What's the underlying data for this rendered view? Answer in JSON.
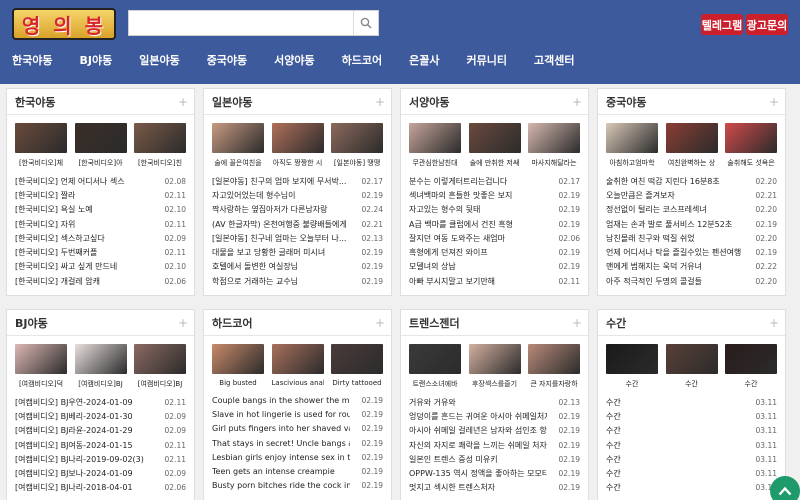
{
  "header": {
    "logo_text": "영 의 봉",
    "search_placeholder": "",
    "buttons": [
      "텔레그램",
      "광고문의"
    ]
  },
  "nav": [
    "한국야동",
    "BJ야동",
    "일본야동",
    "중국야동",
    "서양야동",
    "하드코어",
    "은꼴사",
    "커뮤니티",
    "고객센터"
  ],
  "colors": {
    "header": "#3d5a9c",
    "accent_red": "#cc1f2c",
    "fab": "#1f9a6a"
  },
  "panels": [
    {
      "title": "한국야동",
      "thumbs": [
        "[한국비디오]체",
        "[한국비디오]아",
        "[한국비디오]친"
      ],
      "thumb_colors": [
        "#6a4a3a",
        "#3a2e28",
        "#7a5a48"
      ],
      "items": [
        {
          "title": "[한국비디오] 언제 어디서나 섹스",
          "date": "02.08"
        },
        {
          "title": "[한국비디오] 짤라",
          "date": "02.11"
        },
        {
          "title": "[한국비디오] 욕실 노예",
          "date": "02.10"
        },
        {
          "title": "[한국비디오] 자위",
          "date": "02.11"
        },
        {
          "title": "[한국비디오] 섹스하고싶다",
          "date": "02.09"
        },
        {
          "title": "[한국비디오] 두번째커플",
          "date": "02.11"
        },
        {
          "title": "[한국비디오] 싸고 싶게 만드네",
          "date": "02.10"
        },
        {
          "title": "[한국비디오] 개걸레 암캐",
          "date": "02.06"
        }
      ]
    },
    {
      "title": "일본야동",
      "thumbs": [
        "술에 꼴은여친을",
        "아직도 짱짱한 시",
        "[일본야동] 땡땡"
      ],
      "thumb_colors": [
        "#c89a82",
        "#b0705a",
        "#8c6a5c"
      ],
      "items": [
        {
          "title": "[일본야동] 친구의 엄마 보지에 무서박...",
          "date": "02.17"
        },
        {
          "title": "자고있어었는데 형수님이",
          "date": "02.19"
        },
        {
          "title": "짝사랑하는 옆집아저가 다른남자랑",
          "date": "02.24"
        },
        {
          "title": "(AV 한글자막) 온천여행중 불량배들에게",
          "date": "02.21"
        },
        {
          "title": "[일본야동] 친구네 엄마는 오늘부터 나...",
          "date": "02.13"
        },
        {
          "title": "대물을 보고 당황한 글래머 미시녀",
          "date": "02.19"
        },
        {
          "title": "호텔에서 돌변한 여실장님",
          "date": "02.19"
        },
        {
          "title": "학점으로 거래하는 교수님",
          "date": "02.19"
        }
      ]
    },
    {
      "title": "서양야동",
      "thumbs": [
        "무관심한남친대",
        "술에 만취한 저쌔",
        "마사지해달라는"
      ],
      "thumb_colors": [
        "#c6a59a",
        "#6b4a3e",
        "#d6b8ae"
      ],
      "items": [
        {
          "title": "분수는 이렇게터트리는겁니다",
          "date": "02.17"
        },
        {
          "title": "섹녀백마의 흔들한 맛좋은 보지",
          "date": "02.19"
        },
        {
          "title": "자고있는 형수의 뒷태",
          "date": "02.19"
        },
        {
          "title": "A급 백마를 클럽에서 건진 흑형",
          "date": "02.19"
        },
        {
          "title": "잘지던 여동 도와주는 새엄마",
          "date": "02.06"
        },
        {
          "title": "흑형에게 던져진 와이프",
          "date": "02.19"
        },
        {
          "title": "모델녀의 상납",
          "date": "02.19"
        },
        {
          "title": "아빠 부시지말고 보기만해",
          "date": "02.11"
        }
      ]
    },
    {
      "title": "중국야동",
      "thumbs": [
        "아침하고엄마학",
        "여친완벽하는 상",
        "술취해도 섯욕은"
      ],
      "thumb_colors": [
        "#d9c8b8",
        "#8a3e34",
        "#d04a4a"
      ],
      "items": [
        {
          "title": "술취한 여친 떡감 지린다 16분8초",
          "date": "02.20"
        },
        {
          "title": "오늘만큼은 즐겨보자",
          "date": "02.21"
        },
        {
          "title": "정선없이 털리는 코스프레섹녀",
          "date": "02.20"
        },
        {
          "title": "엄재는 손과 발로 풀서비스 12분52초",
          "date": "02.19"
        },
        {
          "title": "남친몰래 친구와 떡질 쉬었",
          "date": "02.20"
        },
        {
          "title": "언제 어디서나 탁을 즐길수있는 펜션여행",
          "date": "02.19"
        },
        {
          "title": "맨에게 범해지는 욱덕 거유녀",
          "date": "02.22"
        },
        {
          "title": "아주 적극적인 두명의 콜걸들",
          "date": "02.20"
        }
      ]
    },
    {
      "title": "BJ야동",
      "thumbs": [
        "[여캠비디오]덕",
        "[여캠비디오]BJ",
        "[여캠비디오]BJ"
      ],
      "thumb_colors": [
        "#ddb8b4",
        "#e8e0de",
        "#8c6a62"
      ],
      "items": [
        {
          "title": "[여캠비디오] BJ우연-2024-01-09",
          "date": "02.11"
        },
        {
          "title": "[여캠비디오] BJ베리-2024-01-30",
          "date": "02.09"
        },
        {
          "title": "[여캠비디오] BJ라윤-2024-01-29",
          "date": "02.09"
        },
        {
          "title": "[여캠비디오] BJ여동-2024-01-15",
          "date": "02.11"
        },
        {
          "title": "[여캠비디오] BJ나리-2019-09-02(3)",
          "date": "02.11"
        },
        {
          "title": "[여캠비디오] BJ보나-2024-01-09",
          "date": "02.09"
        },
        {
          "title": "[여캠비디오] BJ나리-2018-04-01",
          "date": "02.06"
        }
      ]
    },
    {
      "title": "하드코어",
      "thumbs": [
        "Big busted",
        "Lascivious anal",
        "Dirty tattooed"
      ],
      "thumb_colors": [
        "#c98a6a",
        "#a8705c",
        "#4a3c3a"
      ],
      "items": [
        {
          "title": "Couple bangs in the shower the mornin...",
          "date": "02.19"
        },
        {
          "title": "Slave in hot lingerie is used for rough fu...",
          "date": "02.19"
        },
        {
          "title": "Girl puts fingers into her shaved vagina",
          "date": "02.19"
        },
        {
          "title": "That stays in secret! Uncle bangs a teen'...",
          "date": "02.19"
        },
        {
          "title": "Lesbian girls enjoy intense sex in the livi...",
          "date": "02.19"
        },
        {
          "title": "Teen gets an intense creampie",
          "date": "02.19"
        },
        {
          "title": "Busty porn bitches ride the cock in turns",
          "date": "02.19"
        }
      ]
    },
    {
      "title": "트렌스젠더",
      "thumbs": [
        "트랜스소녀에바",
        "후장섹스를즐기",
        "큰 자지를자랑하"
      ],
      "thumb_colors": [
        "#3a3a3a",
        "#d4b0a0",
        "#b88a7a"
      ],
      "items": [
        {
          "title": "거유와 거유와",
          "date": "02.13"
        },
        {
          "title": "엉덩이를 흔드는 귀여운 아시아 쉬메일처자",
          "date": "02.19"
        },
        {
          "title": "아시아 쉬메일 걸레년은 남자와 섬인조 항문섹...",
          "date": "02.19"
        },
        {
          "title": "자신의 자지로 쾌락을 느끼는 쉬메일 처자",
          "date": "02.19"
        },
        {
          "title": "일본인 트렌스 중성 미유키",
          "date": "02.19"
        },
        {
          "title": "OPPW-135 역시 정액을 좋아하는 모모타니 리리",
          "date": "02.19"
        },
        {
          "title": "멋지고 섹시한 트렌스처자",
          "date": "02.19"
        }
      ]
    },
    {
      "title": "수간",
      "thumbs": [
        "수간",
        "수간",
        "수간"
      ],
      "thumb_colors": [
        "#1a1a1a",
        "#5a4038",
        "#2a1c1c"
      ],
      "items": [
        {
          "title": "수간",
          "date": "03.11"
        },
        {
          "title": "수간",
          "date": "03.11"
        },
        {
          "title": "수간",
          "date": "03.11"
        },
        {
          "title": "수간",
          "date": "03.11"
        },
        {
          "title": "수간",
          "date": "03.11"
        },
        {
          "title": "수간",
          "date": "03.11"
        },
        {
          "title": "수간",
          "date": "03.11"
        }
      ]
    }
  ]
}
